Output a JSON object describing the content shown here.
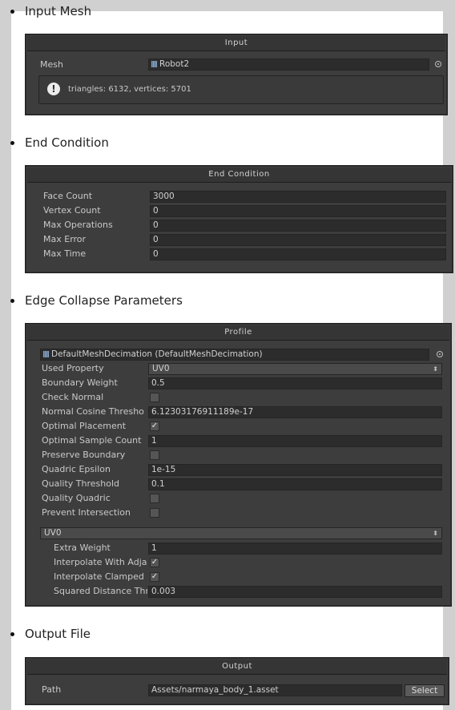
{
  "sections": {
    "input_mesh": "Input Mesh",
    "end_condition": "End Condition",
    "edge_collapse": "Edge Collapse Parameters",
    "output_file": "Output File"
  },
  "input_panel": {
    "title": "Input",
    "mesh_label": "Mesh",
    "mesh_value": "Robot2",
    "help_text": "triangles: 6132, vertices: 5701"
  },
  "end_condition_panel": {
    "title": "End Condition",
    "rows": [
      {
        "label": "Face Count",
        "value": "3000"
      },
      {
        "label": "Vertex Count",
        "value": "0"
      },
      {
        "label": "Max Operations",
        "value": "0"
      },
      {
        "label": "Max Error",
        "value": "0"
      },
      {
        "label": "Max Time",
        "value": "0"
      }
    ]
  },
  "profile_panel": {
    "title": "Profile",
    "asset": "DefaultMeshDecimation (DefaultMeshDecimation)",
    "used_property_label": "Used Property",
    "used_property_value": "UV0",
    "boundary_weight_label": "Boundary Weight",
    "boundary_weight_value": "0.5",
    "check_normal_label": "Check Normal",
    "check_normal": false,
    "normal_cosine_label": "Normal Cosine Thresho",
    "normal_cosine_value": "6.12303176911189e-17",
    "optimal_placement_label": "Optimal Placement",
    "optimal_placement": true,
    "optimal_sample_label": "Optimal Sample Count",
    "optimal_sample_value": "1",
    "preserve_boundary_label": "Preserve Boundary",
    "preserve_boundary": false,
    "quadric_epsilon_label": "Quadric Epsilon",
    "quadric_epsilon_value": "1e-15",
    "quality_threshold_label": "Quality Threshold",
    "quality_threshold_value": "0.1",
    "quality_quadric_label": "Quality Quadric",
    "quality_quadric": false,
    "prevent_intersection_label": "Prevent Intersection",
    "prevent_intersection": false,
    "uv_dropdown": "UV0",
    "extra_weight_label": "Extra Weight",
    "extra_weight_value": "1",
    "interp_adj_label": "Interpolate With Adja",
    "interp_adj": true,
    "interp_clamped_label": "Interpolate Clamped",
    "interp_clamped": true,
    "squared_dist_label": "Squared Distance Thr",
    "squared_dist_value": "0.003"
  },
  "output_panel": {
    "title": "Output",
    "path_label": "Path",
    "path_value": "Assets/narmaya_body_1.asset",
    "select_label": "Select"
  },
  "colors": {
    "panel_bg": "#3d3d3d",
    "field_bg": "#2c2c2c",
    "label_text": "#c9c9c9",
    "page_gray": "#d0d0d0"
  }
}
